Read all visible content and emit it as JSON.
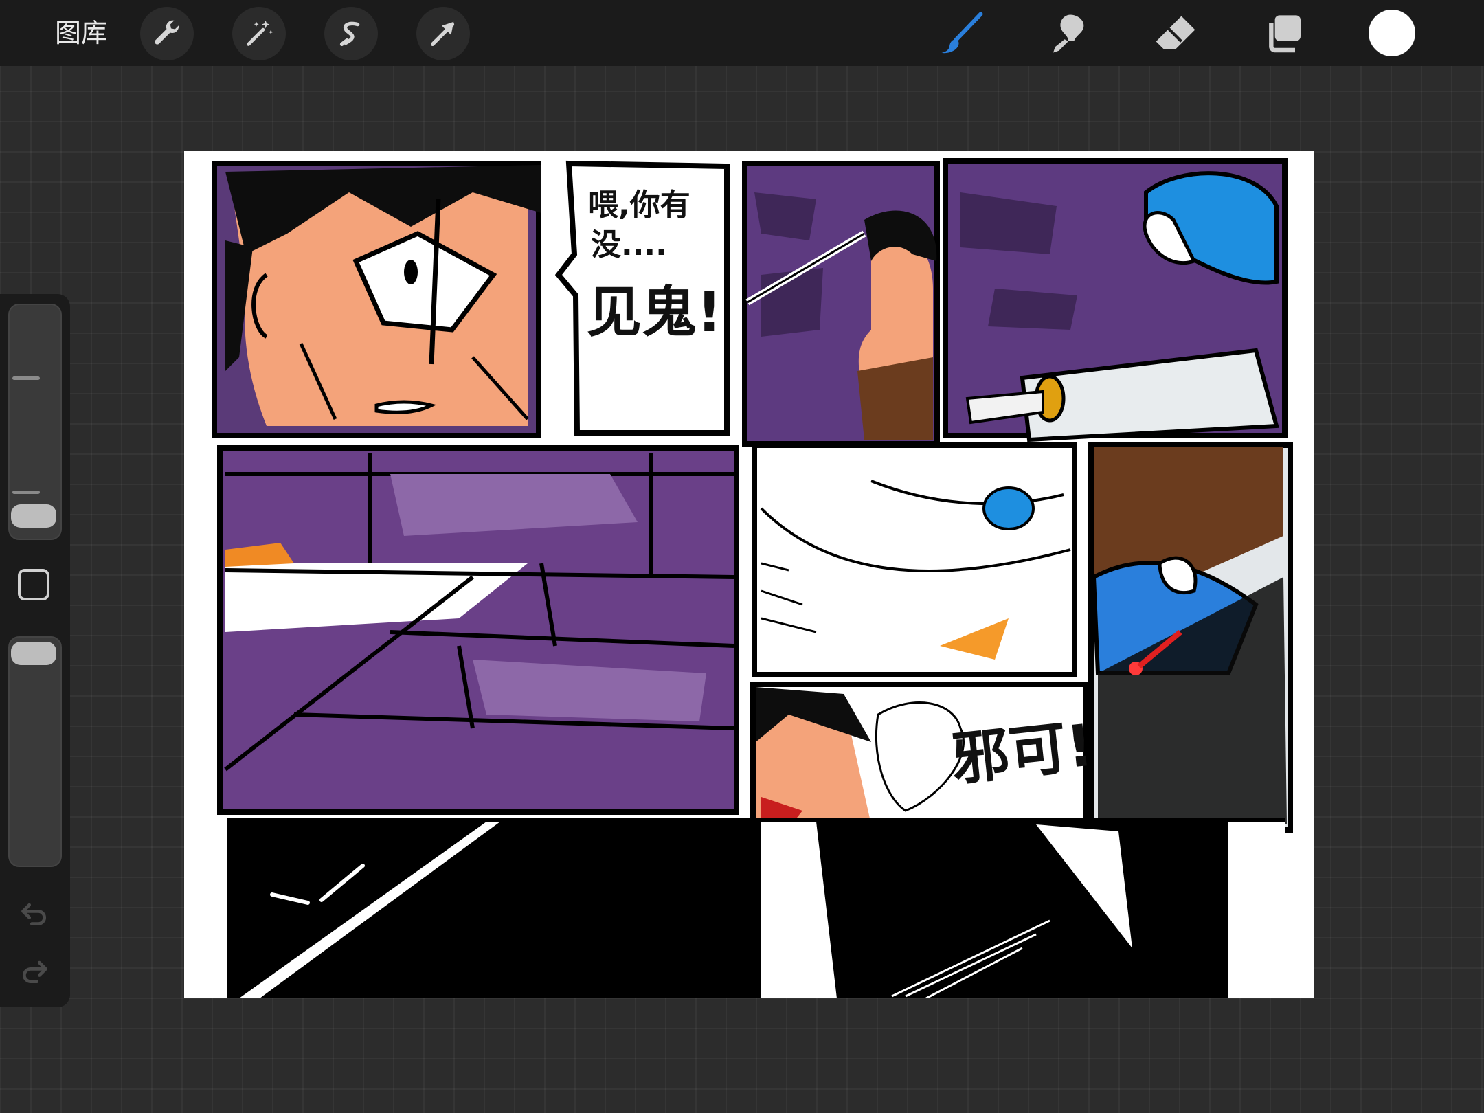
{
  "toolbar": {
    "gallery_label": "图库",
    "icons_left": [
      "wrench-icon",
      "magic-wand-icon",
      "selection-s-icon",
      "move-arrow-icon"
    ],
    "icons_right": [
      "brush-icon",
      "smudge-icon",
      "eraser-icon",
      "layers-icon"
    ],
    "current_color": "#ffffff",
    "brush_color": "#2a7fdc"
  },
  "comic": {
    "bubble_line1": "喂,你有",
    "bubble_line2": "没....",
    "bubble_line3": "见鬼!",
    "sfx": "邪可!"
  }
}
